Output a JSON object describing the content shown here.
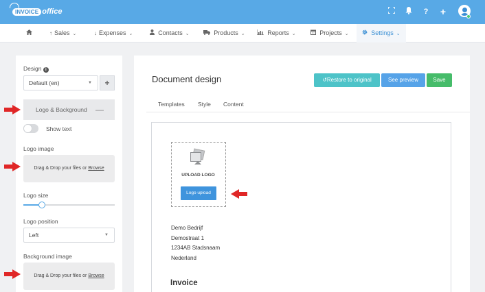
{
  "brand": {
    "logo_part1": "INVOICE",
    "logo_part2": "office"
  },
  "topbar": {
    "help_label": "?",
    "add_label": "+"
  },
  "nav": {
    "items": [
      {
        "label": "Sales",
        "icon": "upload-arrow-icon"
      },
      {
        "label": "Expenses",
        "icon": "download-arrow-icon"
      },
      {
        "label": "Contacts",
        "icon": "user-icon"
      },
      {
        "label": "Products",
        "icon": "truck-icon"
      },
      {
        "label": "Reports",
        "icon": "bar-chart-icon"
      },
      {
        "label": "Projects",
        "icon": "calendar-icon"
      },
      {
        "label": "Settings",
        "icon": "gear-icon",
        "active": true
      }
    ]
  },
  "sidebar": {
    "design_label": "Design",
    "design_value": "Default (en)",
    "add_design_label": "+",
    "accordion_label": "Logo & Background",
    "accordion_toggle": "—",
    "show_text_label": "Show text",
    "show_text_on": false,
    "logo_image_label": "Logo image",
    "dropzone_text": "Drag & Drop your files or ",
    "dropzone_browse": "Browse",
    "logo_size_label": "Logo size",
    "logo_size_value": 0.2,
    "logo_position_label": "Logo position",
    "logo_position_value": "Left",
    "background_image_label": "Background image"
  },
  "main": {
    "title": "Document design",
    "restore_label": "Restore to original",
    "preview_label": "See preview",
    "save_label": "Save",
    "tabs": [
      "Templates",
      "Style",
      "Content"
    ],
    "upload_logo_title": "UPLOAD LOGO",
    "logo_upload_button": "Logo upload",
    "address": [
      "Demo Bedrijf",
      "Demostraat 1",
      "1234AB Stadsnaam",
      "Nederland"
    ],
    "invoice_heading": "Invoice"
  },
  "colors": {
    "topbar": "#58a9e6",
    "accent": "#3a8fd4",
    "restore": "#4dc3c8",
    "preview": "#56a3e8",
    "save": "#46bc6a",
    "annotation_arrow": "#e02727"
  }
}
